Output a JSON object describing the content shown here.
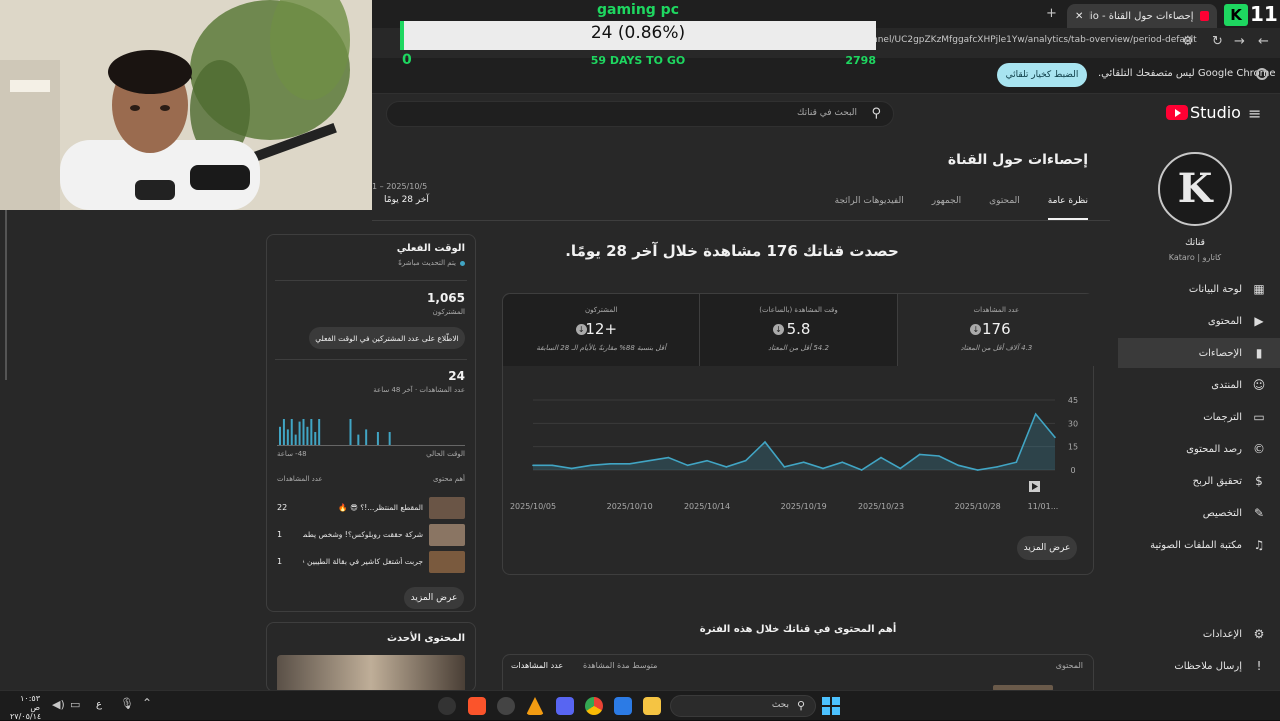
{
  "browser": {
    "tab_title": "إحصاءات حول القناة - YouTube Studio",
    "url": "nnel/UC2gpZKzMfggafcXHPjle1Yw/analytics/tab-overview/period-default",
    "infobar_text": "Google Chrome ليس متصفحك التلقائي.",
    "infobar_button": "الضبط كخيار تلقائي"
  },
  "overlay": {
    "title": "gaming pc",
    "value": "24 (0.86%)",
    "progress_fraction": 0.0086,
    "min": "0",
    "days_left": "59 DAYS TO GO",
    "goal": "2798",
    "badge": "11"
  },
  "header": {
    "logo": "Studio",
    "search_placeholder": "البحث في قناتك"
  },
  "sidebar": {
    "channel_label": "قناتك",
    "channel_name": "Kataro | كاتارو",
    "items": [
      {
        "label": "لوحة البيانات",
        "icon": "dashboard-icon",
        "glyph": "▦"
      },
      {
        "label": "المحتوى",
        "icon": "content-icon",
        "glyph": "▶"
      },
      {
        "label": "الإحصاءات",
        "icon": "analytics-icon",
        "glyph": "▮"
      },
      {
        "label": "المنتدى",
        "icon": "community-icon",
        "glyph": "☺"
      },
      {
        "label": "الترجمات",
        "icon": "subtitles-icon",
        "glyph": "▭"
      },
      {
        "label": "رصد المحتوى",
        "icon": "copyright-icon",
        "glyph": "©"
      },
      {
        "label": "تحقيق الربح",
        "icon": "earn-icon",
        "glyph": "$"
      },
      {
        "label": "التخصيص",
        "icon": "customization-icon",
        "glyph": "✎"
      },
      {
        "label": "مكتبة الملفات الصوتية",
        "icon": "audio-library-icon",
        "glyph": "♫"
      }
    ],
    "settings": "الإعدادات",
    "feedback": "إرسال ملاحظات"
  },
  "main": {
    "title": "إحصاءات حول القناة",
    "tabs": [
      "نظرة عامة",
      "المحتوى",
      "الجمهور",
      "الفيديوهات الرائجة"
    ],
    "date_range": "2025/10/5 – 1",
    "date_label": "آخر 28 يومًا",
    "headline": "حصدت قناتك 176 مشاهدة خلال آخر 28 يومًا.",
    "metrics": [
      {
        "label": "عدد المشاهدات",
        "value": "176",
        "sub": "4.3 آلاف أقل من المعتاد"
      },
      {
        "label": "وقت المشاهدة (بالساعات)",
        "value": "5.8",
        "sub": "54.2 أقل من المعتاد"
      },
      {
        "label": "المشتركون",
        "value": "+12",
        "sub": "أقل بنسبة 88% مقارنةً بالأيام الـ 28 السابقة"
      }
    ],
    "show_more": "عرض المزيد",
    "top_content_title": "أهم المحتوى في قناتك خلال هذه الفترة",
    "table_headers": [
      "المحتوى",
      "متوسط مدة المشاهدة",
      "عدد المشاهدات"
    ]
  },
  "chart_data": {
    "type": "area",
    "x": [
      "2025/10/05",
      "2025/10/06",
      "2025/10/07",
      "2025/10/08",
      "2025/10/09",
      "2025/10/10",
      "2025/10/11",
      "2025/10/12",
      "2025/10/13",
      "2025/10/14",
      "2025/10/15",
      "2025/10/16",
      "2025/10/17",
      "2025/10/18",
      "2025/10/19",
      "2025/10/20",
      "2025/10/21",
      "2025/10/22",
      "2025/10/23",
      "2025/10/24",
      "2025/10/25",
      "2025/10/26",
      "2025/10/27",
      "2025/10/28",
      "2025/10/29",
      "2025/10/30",
      "2025/10/31",
      "2025/11/01"
    ],
    "series": [
      {
        "values": [
          3,
          3,
          1,
          3,
          4,
          4,
          6,
          8,
          3,
          6,
          2,
          6,
          18,
          2,
          5,
          1,
          5,
          0,
          8,
          1,
          10,
          9,
          3,
          0,
          2,
          5,
          36,
          21
        ]
      }
    ],
    "x_tick_labels": [
      "2025/10/05",
      "2025/10/10",
      "2025/10/14",
      "2025/10/19",
      "2025/10/23",
      "2025/10/28",
      "11/01..."
    ],
    "y_ticks": [
      0,
      15,
      30,
      45
    ],
    "ylim": [
      0,
      45
    ],
    "grid": true,
    "color": "#41a5c4"
  },
  "realtime": {
    "title": "الوقت الفعلي",
    "live_text": "يتم التحديث مباشرةً",
    "subscribers_value": "1,065",
    "subscribers_label": "المشتركون",
    "see_live_button": "الاطّلاع على عدد المشتركين في الوقت الفعلي",
    "views_value": "24",
    "views_label": "عدد المشاهدات · آخر 48 ساعة",
    "now_label": "الوقت الحالي",
    "ago_label": "48- ساعة",
    "top_content_label": "أهم محتوى",
    "views_col_label": "عدد المشاهدات",
    "bars": [
      0.7,
      1,
      0.6,
      1,
      0.4,
      0.9,
      1,
      0.7,
      1,
      0.5,
      1,
      0,
      0,
      0,
      0,
      0,
      0,
      0,
      1,
      0,
      0.4,
      0,
      0.6,
      0,
      0,
      0.5,
      0,
      0,
      0.5
    ],
    "videos": [
      {
        "title": "المقطع المنتظر...!؟ 😎 🔥",
        "views": "22"
      },
      {
        "title": "شركة حققت روبلوكس؟! وشخص يطمن ...",
        "views": "1"
      },
      {
        "title": "جربت أشتغل كاشير في بقالة الطيبين 😂 ...",
        "views": "1"
      }
    ],
    "show_more": "عرض المزيد",
    "latest_title": "المحتوى الأحدث"
  },
  "taskbar": {
    "search_placeholder": "بحث",
    "time": "١٠:٥٣ ص",
    "date": "٢٧/٠٥/١٤",
    "lang": "ع"
  }
}
